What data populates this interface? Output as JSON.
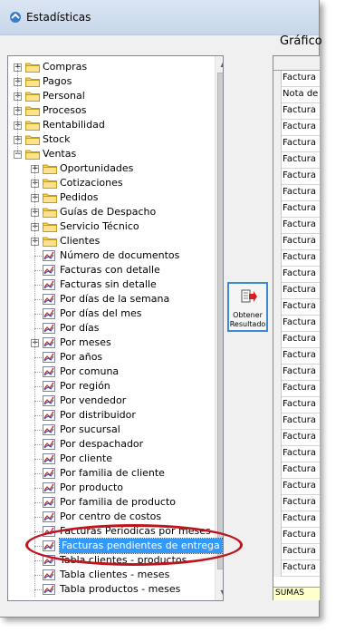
{
  "window": {
    "title": "Estadísticas"
  },
  "header": {
    "grafico_label": "Gráfico"
  },
  "tree": {
    "top_items": [
      {
        "label": "Compras",
        "expander": "+"
      },
      {
        "label": "Pagos",
        "expander": "+"
      },
      {
        "label": "Personal",
        "expander": "+"
      },
      {
        "label": "Procesos",
        "expander": "+"
      },
      {
        "label": "Rentabilidad",
        "expander": "+"
      },
      {
        "label": "Stock",
        "expander": "+"
      },
      {
        "label": "Ventas",
        "expander": "−"
      }
    ],
    "ventas_folders": [
      {
        "label": "Oportunidades",
        "expander": "+"
      },
      {
        "label": "Cotizaciones",
        "expander": "+"
      },
      {
        "label": "Pedidos",
        "expander": "+"
      },
      {
        "label": "Guías de Despacho",
        "expander": "+"
      },
      {
        "label": "Servicio Técnico",
        "expander": "+"
      },
      {
        "label": "Clientes",
        "expander": "+"
      }
    ],
    "reports": [
      {
        "label": "Número de documentos"
      },
      {
        "label": "Facturas con detalle"
      },
      {
        "label": "Facturas sin detalle"
      },
      {
        "label": "Por días de la semana"
      },
      {
        "label": "Por días del mes"
      },
      {
        "label": "Por días"
      },
      {
        "label": "Por meses",
        "expander": "+"
      },
      {
        "label": "Por años"
      },
      {
        "label": "Por comuna"
      },
      {
        "label": "Por región"
      },
      {
        "label": "Por vendedor"
      },
      {
        "label": "Por distribuidor"
      },
      {
        "label": "Por sucursal"
      },
      {
        "label": "Por despachador"
      },
      {
        "label": "Por cliente"
      },
      {
        "label": "Por familia de cliente"
      },
      {
        "label": "Por producto"
      },
      {
        "label": "Por familia de producto"
      },
      {
        "label": "Por centro de costos"
      },
      {
        "label": "Facturas Periodicas por meses"
      },
      {
        "label": "Facturas pendientes de entrega",
        "selected": true
      },
      {
        "label": "Tabla clientes - productos"
      },
      {
        "label": "Tabla clientes - meses"
      },
      {
        "label": "Tabla productos - meses"
      }
    ]
  },
  "obtain_button": {
    "line1": "Obtener",
    "line2": "Resultado"
  },
  "grid": {
    "rows": [
      "Factura",
      "Nota de",
      "Factura",
      "Factura",
      "Factura",
      "Factura",
      "Factura",
      "Factura",
      "Factura",
      "Factura",
      "Factura",
      "Factura",
      "Factura",
      "Factura",
      "Factura",
      "Factura",
      "Factura",
      "Factura",
      "Factura",
      "Factura",
      "Factura",
      "Factura",
      "Factura",
      "Factura",
      "Factura",
      "Factura",
      "Factura",
      "Factura",
      "Factura",
      "Factura",
      "Factura"
    ],
    "footer": "SUMAS"
  },
  "colors": {
    "selection": "#3399ff",
    "annotation": "#c0141c",
    "button_border": "#3c8ad6"
  }
}
